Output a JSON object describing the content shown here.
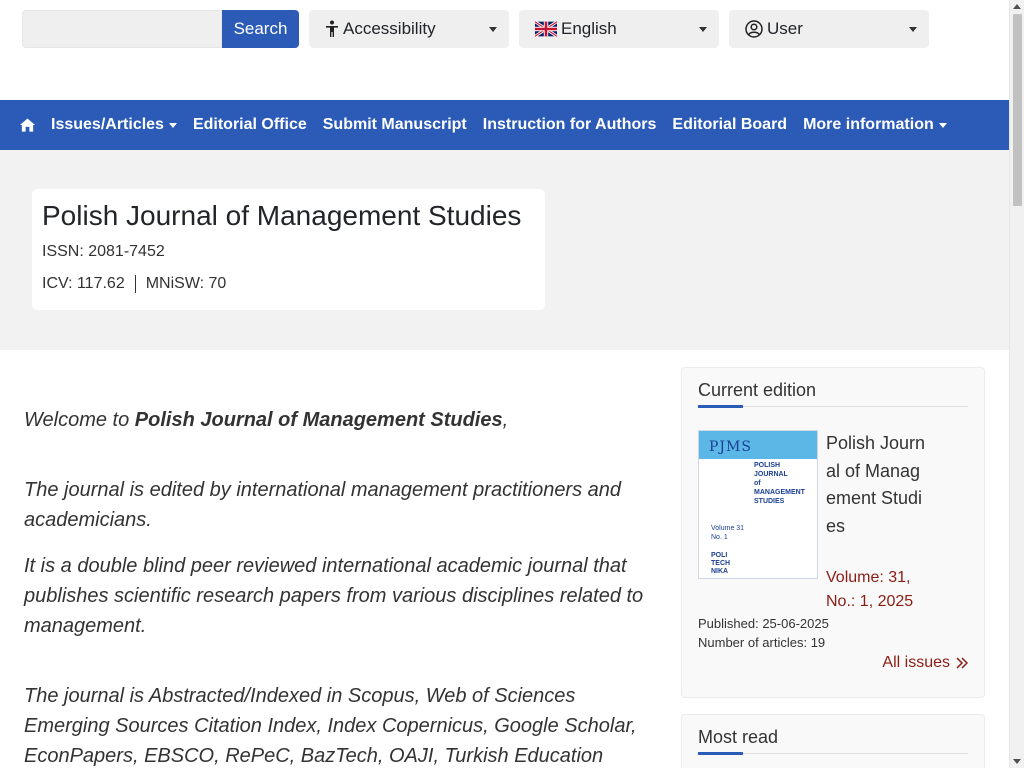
{
  "search": {
    "placeholder": "",
    "button_label": "Search"
  },
  "dropdowns": {
    "accessibility": "Accessibility",
    "language": "English",
    "user": "User"
  },
  "nav": {
    "home_icon": "home-icon",
    "items": [
      {
        "label": "Issues/Articles",
        "has_dropdown": true
      },
      {
        "label": "Editorial Office",
        "has_dropdown": false
      },
      {
        "label": "Submit Manuscript",
        "has_dropdown": false
      },
      {
        "label": "Instruction for Authors",
        "has_dropdown": false
      },
      {
        "label": "Editorial Board",
        "has_dropdown": false
      },
      {
        "label": "More information",
        "has_dropdown": true
      }
    ]
  },
  "journal": {
    "title": "Polish Journal of Management Studies",
    "issn": "ISSN: 2081-7452",
    "icv": "ICV: 117.62",
    "mnisw": "MNiSW: 70"
  },
  "main": {
    "welcome_prefix": "Welcome to ",
    "welcome_bold": "Polish Journal of Management Studies",
    "welcome_suffix": ",",
    "p1": "The journal is edited by international management practitioners and academicians.",
    "p2": "It is a double blind peer reviewed international academic journal that publishes scientific research papers from various disciplines related to management.",
    "p3": "The journal is Abstracted/Indexed in Scopus, Web of Sciences Emerging Sources Citation Index, Index Copernicus, Google Scholar, EconPapers, EBSCO, RePeC, BazTech, OAJI, Turkish Education"
  },
  "current_edition": {
    "heading": "Current edition",
    "cover": {
      "mark": "PJMS",
      "title_lines": [
        "POLISH",
        "JOURNAL",
        "of",
        "MANAGEMENT",
        "STUDIES"
      ],
      "volume_line": "Volume 31",
      "number_line": "No. 1",
      "logo_lines": [
        "POLI",
        "TECH",
        "NIKA"
      ]
    },
    "title": "Polish Journal of Management Studies",
    "volume": "Volume: 31, No.: 1, 2025",
    "published": "Published: 25-06-2025",
    "articles": "Number of articles: 19",
    "all_issues": "All issues"
  },
  "most_read": {
    "heading": "Most read"
  },
  "colors": {
    "brand": "#2b5bb7",
    "link_dark_red": "#8a1d14",
    "hero_bg": "#f2f2f2"
  }
}
